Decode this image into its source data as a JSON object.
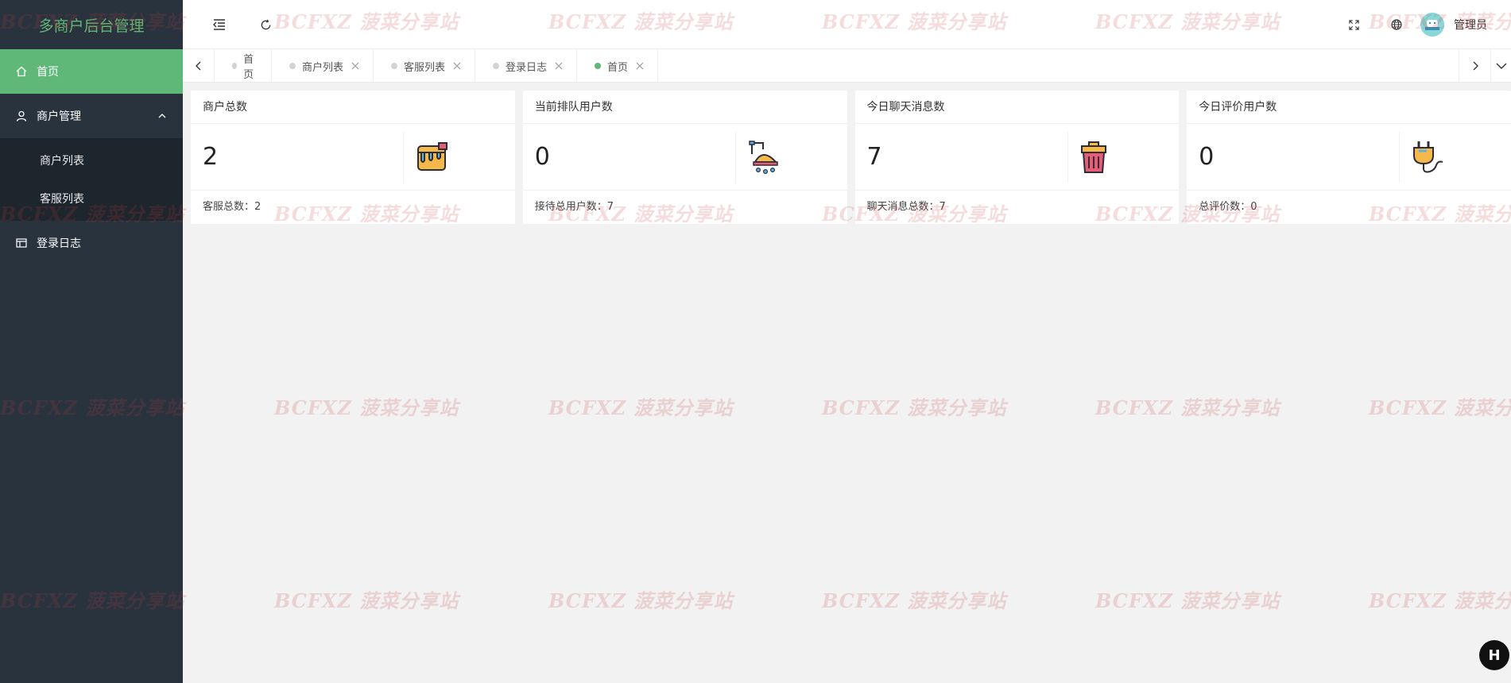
{
  "sidebar": {
    "logo": "多商户后台管理",
    "items": [
      {
        "label": "首页",
        "icon": "home-icon",
        "active": true
      },
      {
        "label": "商户管理",
        "icon": "user-icon",
        "expanded": true,
        "children": [
          {
            "label": "商户列表"
          },
          {
            "label": "客服列表"
          }
        ]
      },
      {
        "label": "登录日志",
        "icon": "log-icon"
      }
    ]
  },
  "header": {
    "user_name": "管理员"
  },
  "tabs": [
    {
      "label": "首页",
      "closable": false
    },
    {
      "label": "商户列表",
      "closable": true
    },
    {
      "label": "客服列表",
      "closable": true
    },
    {
      "label": "登录日志",
      "closable": true
    },
    {
      "label": "首页",
      "closable": true,
      "current": true
    }
  ],
  "cards": [
    {
      "title": "商户总数",
      "value": "2",
      "footer": "客服总数：2",
      "icon": "paint-bucket-icon"
    },
    {
      "title": "当前排队用户数",
      "value": "0",
      "footer": "接待总用户数：7",
      "icon": "shower-icon"
    },
    {
      "title": "今日聊天消息数",
      "value": "7",
      "footer": "聊天消息总数：7",
      "icon": "trash-bin-icon"
    },
    {
      "title": "今日评价用户数",
      "value": "0",
      "footer": "总评价数：0",
      "icon": "plug-icon"
    }
  ],
  "watermark": {
    "text": "BCFXZ 菠菜分享站"
  },
  "colors": {
    "accent": "#5fb878",
    "sidebar_bg": "#28333e",
    "submenu_bg": "#1d252d",
    "page_bg": "#f2f2f2"
  }
}
